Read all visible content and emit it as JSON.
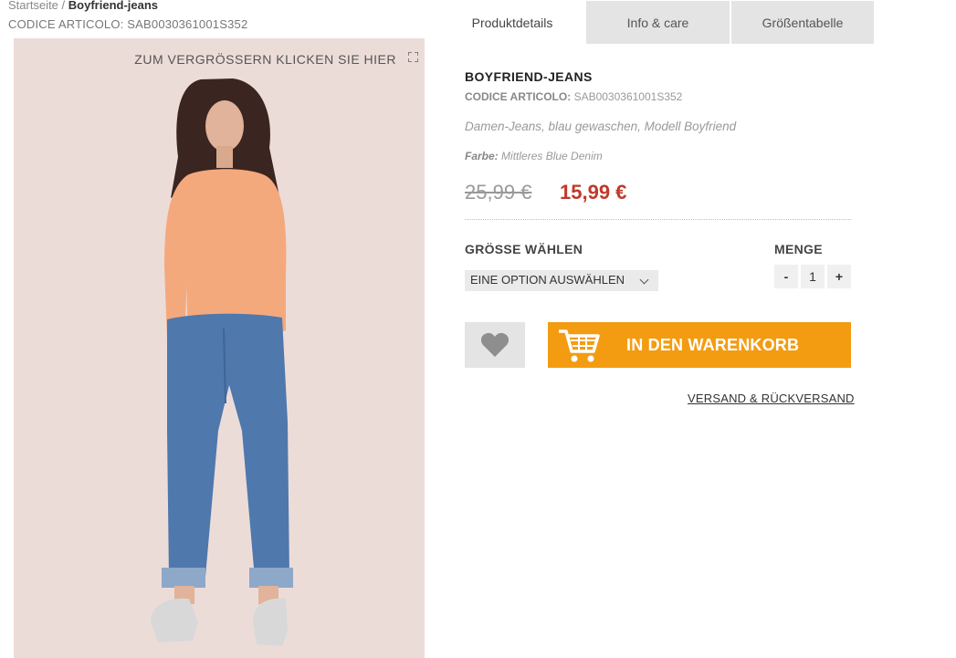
{
  "breadcrumb": {
    "home": "Startseite",
    "separator": "/",
    "current": "Boyfriend-jeans"
  },
  "top_sku": "CODICE ARTICOLO: SAB0030361001S352",
  "image": {
    "zoom_text": "ZUM VERGRÖSSERN KLICKEN SIE HIER"
  },
  "tabs": [
    {
      "label": "Produktdetails",
      "active": true
    },
    {
      "label": "Info & care",
      "active": false
    },
    {
      "label": "Größentabelle",
      "active": false
    }
  ],
  "product": {
    "title": "BOYFRIEND-JEANS",
    "sku_label": "CODICE ARTICOLO:",
    "sku_value": "SAB0030361001S352",
    "description": "Damen-Jeans, blau gewaschen, Modell Boyfriend",
    "color_label": "Farbe:",
    "color_value": "Mittleres Blue Denim",
    "old_price": "25,99 €",
    "new_price": "15,99 €"
  },
  "size": {
    "label": "GRÖSSE WÄHLEN",
    "selected": "EINE OPTION AUSWÄHLEN"
  },
  "quantity": {
    "label": "MENGE",
    "minus": "-",
    "value": "1",
    "plus": "+"
  },
  "actions": {
    "cart_label": "IN DEN WARENKORB",
    "wishlist_icon": "heart-icon",
    "cart_icon": "shopping-cart-icon"
  },
  "shipping_link": "VERSAND & RÜCKVERSAND",
  "colors": {
    "accent": "#f39c12",
    "sale_price": "#c0392b",
    "tab_inactive": "#e4e4e4"
  }
}
